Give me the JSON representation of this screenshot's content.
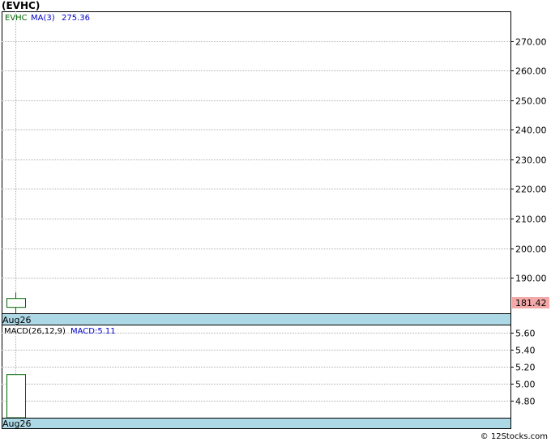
{
  "title": "(EVHC)",
  "copyright": "© 12Stocks.com",
  "colors": {
    "ticker_text": "#006400",
    "ma_text": "#0000cc",
    "macd_text": "#000000",
    "macd_value_text": "#0000cc",
    "date_band": "#add8e6",
    "price_badge": "#f4a9a9",
    "grid": "#b0b0b0",
    "candle": "#006400"
  },
  "price_panel": {
    "ticker_label": "EVHC",
    "ma_label": "MA(3)",
    "ma_value": "275.36",
    "last_price_label": "181.42",
    "date_label": "Aug26"
  },
  "macd_panel": {
    "label": "MACD(26,12,9)",
    "value_label": "MACD:5.11",
    "date_label": "Aug26"
  },
  "chart_data": [
    {
      "type": "candlestick",
      "title": "(EVHC)",
      "x": [
        "Aug26"
      ],
      "ylim": [
        178.0,
        280.0
      ],
      "ticks": [
        270.0,
        260.0,
        250.0,
        240.0,
        230.0,
        220.0,
        210.0,
        200.0,
        190.0
      ],
      "tick_labels": [
        "270.00",
        "260.00",
        "250.00",
        "240.00",
        "230.00",
        "220.00",
        "210.00",
        "200.00",
        "190.00"
      ],
      "series": [
        {
          "name": "EVHC",
          "ohlc": [
            [
              180.0,
              185.0,
              178.0,
              183.0
            ]
          ]
        }
      ],
      "last_price": 181.42,
      "grid": true
    },
    {
      "type": "bar",
      "title": "MACD(26,12,9)",
      "x": [
        "Aug26"
      ],
      "ylim": [
        4.6,
        5.7
      ],
      "ticks": [
        5.6,
        5.4,
        5.2,
        5.0,
        4.8
      ],
      "tick_labels": [
        "5.60",
        "5.40",
        "5.20",
        "5.00",
        "4.80"
      ],
      "series": [
        {
          "name": "MACD",
          "values": [
            5.11
          ]
        }
      ],
      "grid": true
    }
  ]
}
